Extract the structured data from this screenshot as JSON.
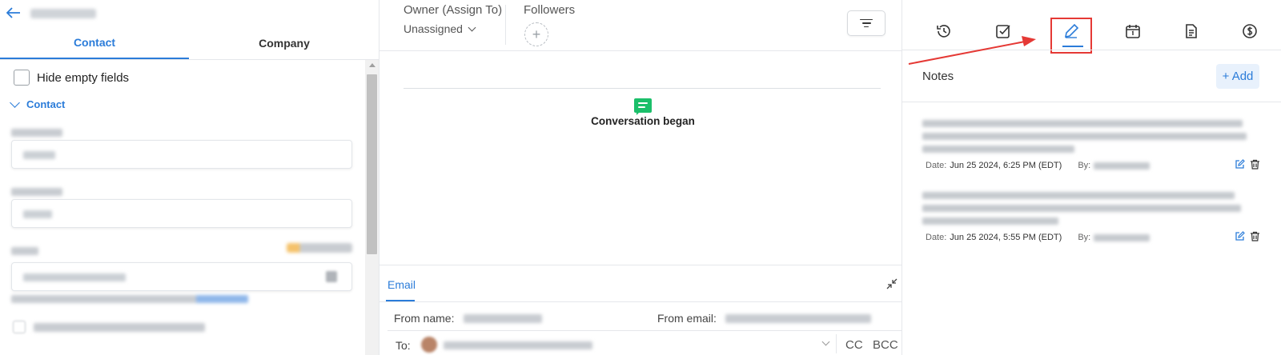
{
  "left": {
    "back_icon": "arrow-left-icon",
    "tabs": [
      {
        "label": "Contact",
        "active": true
      },
      {
        "label": "Company",
        "active": false
      }
    ],
    "hide_empty_label": "Hide empty fields",
    "section_label": "Contact"
  },
  "middle": {
    "owner_label": "Owner (Assign To)",
    "owner_value": "Unassigned",
    "followers_label": "Followers",
    "add_follower_glyph": "+",
    "conversation_text": "Conversation began",
    "composer": {
      "tab_label": "Email",
      "from_name_label": "From name:",
      "from_email_label": "From email:",
      "to_label": "To:",
      "cc_label": "CC",
      "bcc_label": "BCC"
    }
  },
  "right": {
    "icons": [
      "history-icon",
      "task-check-icon",
      "pen-icon",
      "calendar-icon",
      "document-icon",
      "dollar-icon"
    ],
    "active_icon": "pen-icon",
    "notes_title": "Notes",
    "add_label": "+ Add",
    "notes": [
      {
        "date_label": "Date:",
        "date_value": "Jun 25 2024, 6:25 PM (EDT)",
        "by_label": "By:"
      },
      {
        "date_label": "Date:",
        "date_value": "Jun 25 2024, 5:55 PM (EDT)",
        "by_label": "By:"
      }
    ]
  },
  "colors": {
    "accent": "#2b7cd9",
    "annotation_red": "#e53935",
    "chat_green": "#1bbf6a"
  }
}
